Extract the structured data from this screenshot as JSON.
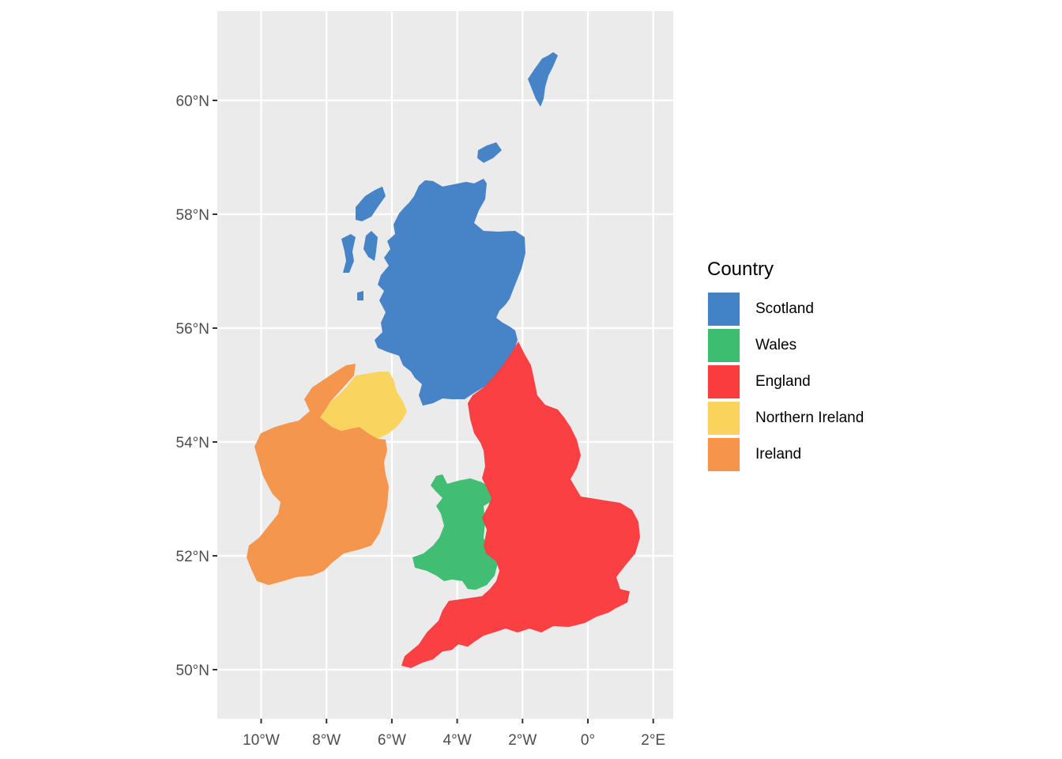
{
  "chart_data": {
    "type": "map",
    "title": "",
    "xlabel": "",
    "ylabel": "",
    "x_ticks": [
      "10°W",
      "8°W",
      "6°W",
      "4°W",
      "2°W",
      "0°",
      "2°E"
    ],
    "x_tick_values": [
      -10,
      -8,
      -6,
      -4,
      -2,
      0,
      2
    ],
    "y_ticks": [
      "60°N",
      "58°N",
      "56°N",
      "54°N",
      "52°N",
      "50°N"
    ],
    "y_tick_values": [
      60,
      58,
      56,
      54,
      52,
      50
    ],
    "xlim": [
      -11.1,
      2.9
    ],
    "ylim": [
      49.3,
      61.6
    ],
    "grid": true,
    "legend": {
      "title": "Country",
      "placement": "right",
      "entries": [
        {
          "name": "Scotland",
          "color": "#4282C6"
        },
        {
          "name": "Wales",
          "color": "#3DBD70"
        },
        {
          "name": "England",
          "color": "#FA3C3F"
        },
        {
          "name": "Northern Ireland",
          "color": "#F9D35C"
        },
        {
          "name": "Ireland",
          "color": "#F5944A"
        }
      ]
    },
    "regions": [
      {
        "name": "Scotland",
        "color": "#4282C6"
      },
      {
        "name": "Wales",
        "color": "#3DBD70"
      },
      {
        "name": "England",
        "color": "#FA3C3F"
      },
      {
        "name": "Northern Ireland",
        "color": "#F9D35C"
      },
      {
        "name": "Ireland",
        "color": "#F5944A"
      }
    ]
  },
  "colors": {
    "panel_background": "#EBEBEB",
    "grid": "#FFFFFF",
    "axis_text": "#4D4D4D"
  }
}
